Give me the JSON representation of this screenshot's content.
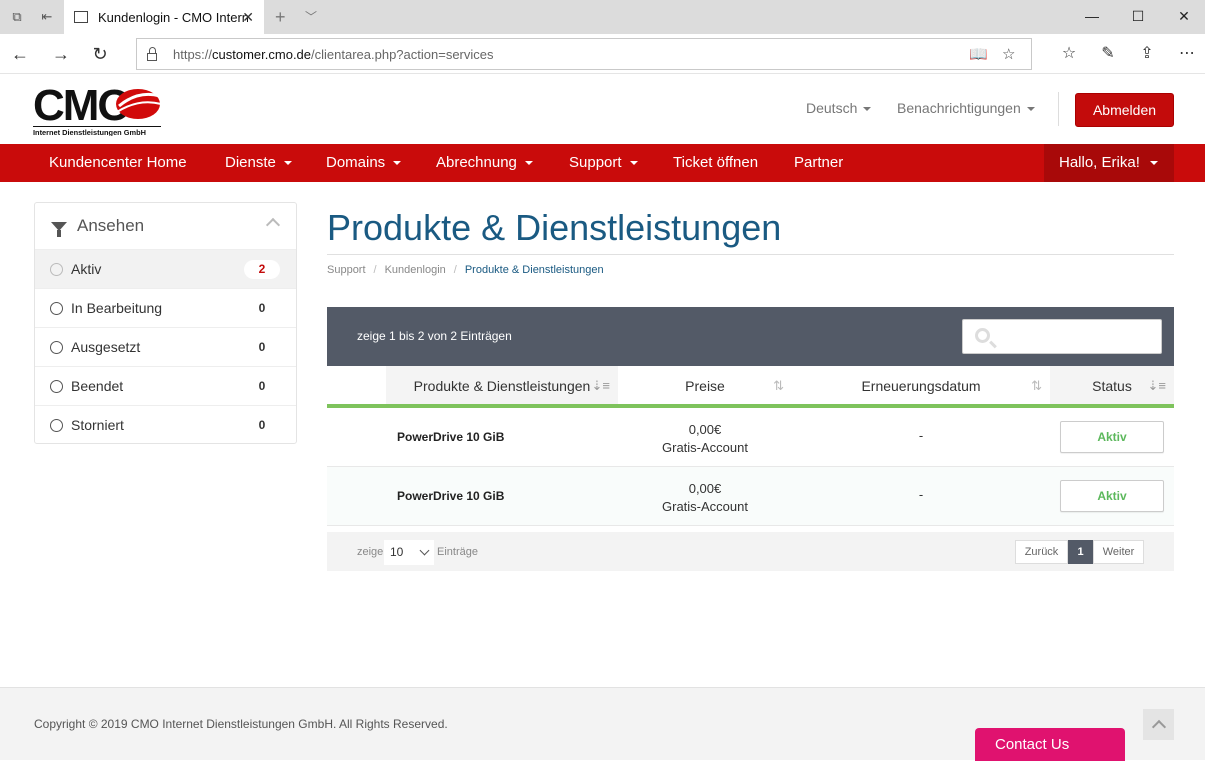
{
  "browser": {
    "tab_title": "Kundenlogin - CMO Internet Dienstleistungen",
    "url_prefix": "https://",
    "url_host": "customer.cmo.de",
    "url_path": "/clientarea.php?action=services"
  },
  "header": {
    "logo_big": "CMO",
    "logo_sub": "Internet Dienstleistungen GmbH",
    "language": "Deutsch",
    "notifications": "Benachrichtigungen",
    "logout": "Abmelden"
  },
  "nav": {
    "items": [
      "Kundencenter Home",
      "Dienste",
      "Domains",
      "Abrechnung",
      "Support",
      "Ticket öffnen",
      "Partner"
    ],
    "user": "Hallo, Erika!"
  },
  "sidebar": {
    "title": "Ansehen",
    "filters": [
      {
        "label": "Aktiv",
        "count": "2"
      },
      {
        "label": "In Bearbeitung",
        "count": "0"
      },
      {
        "label": "Ausgesetzt",
        "count": "0"
      },
      {
        "label": "Beendet",
        "count": "0"
      },
      {
        "label": "Storniert",
        "count": "0"
      }
    ]
  },
  "page": {
    "title": "Produkte & Dienstleistungen",
    "breadcrumb": [
      "Support",
      "Kundenlogin",
      "Produkte & Dienstleistungen"
    ]
  },
  "table": {
    "info": "zeige 1 bis 2 von 2 Einträgen",
    "search_placeholder": "",
    "columns": [
      "Produkte & Dienstleistungen",
      "Preise",
      "Erneuerungsdatum",
      "Status"
    ],
    "rows": [
      {
        "name": "PowerDrive 10 GiB",
        "price": "0,00€",
        "billing": "Gratis-Account",
        "renewal": "-",
        "status": "Aktiv"
      },
      {
        "name": "PowerDrive 10 GiB",
        "price": "0,00€",
        "billing": "Gratis-Account",
        "renewal": "-",
        "status": "Aktiv"
      }
    ],
    "length_prefix": "zeige",
    "length_value": "10",
    "length_suffix": "Einträge",
    "prev": "Zurück",
    "page": "1",
    "next": "Weiter"
  },
  "footer": {
    "copyright": "Copyright © 2019 CMO Internet Dienstleistungen GmbH. All Rights Reserved.",
    "contact": "Contact Us"
  },
  "colors": {
    "brand_red": "#c90b0b",
    "title_blue": "#1a5a82",
    "status_green": "#5cb85c",
    "table_header_dark": "#535a67",
    "contact_pink": "#e0126f"
  }
}
